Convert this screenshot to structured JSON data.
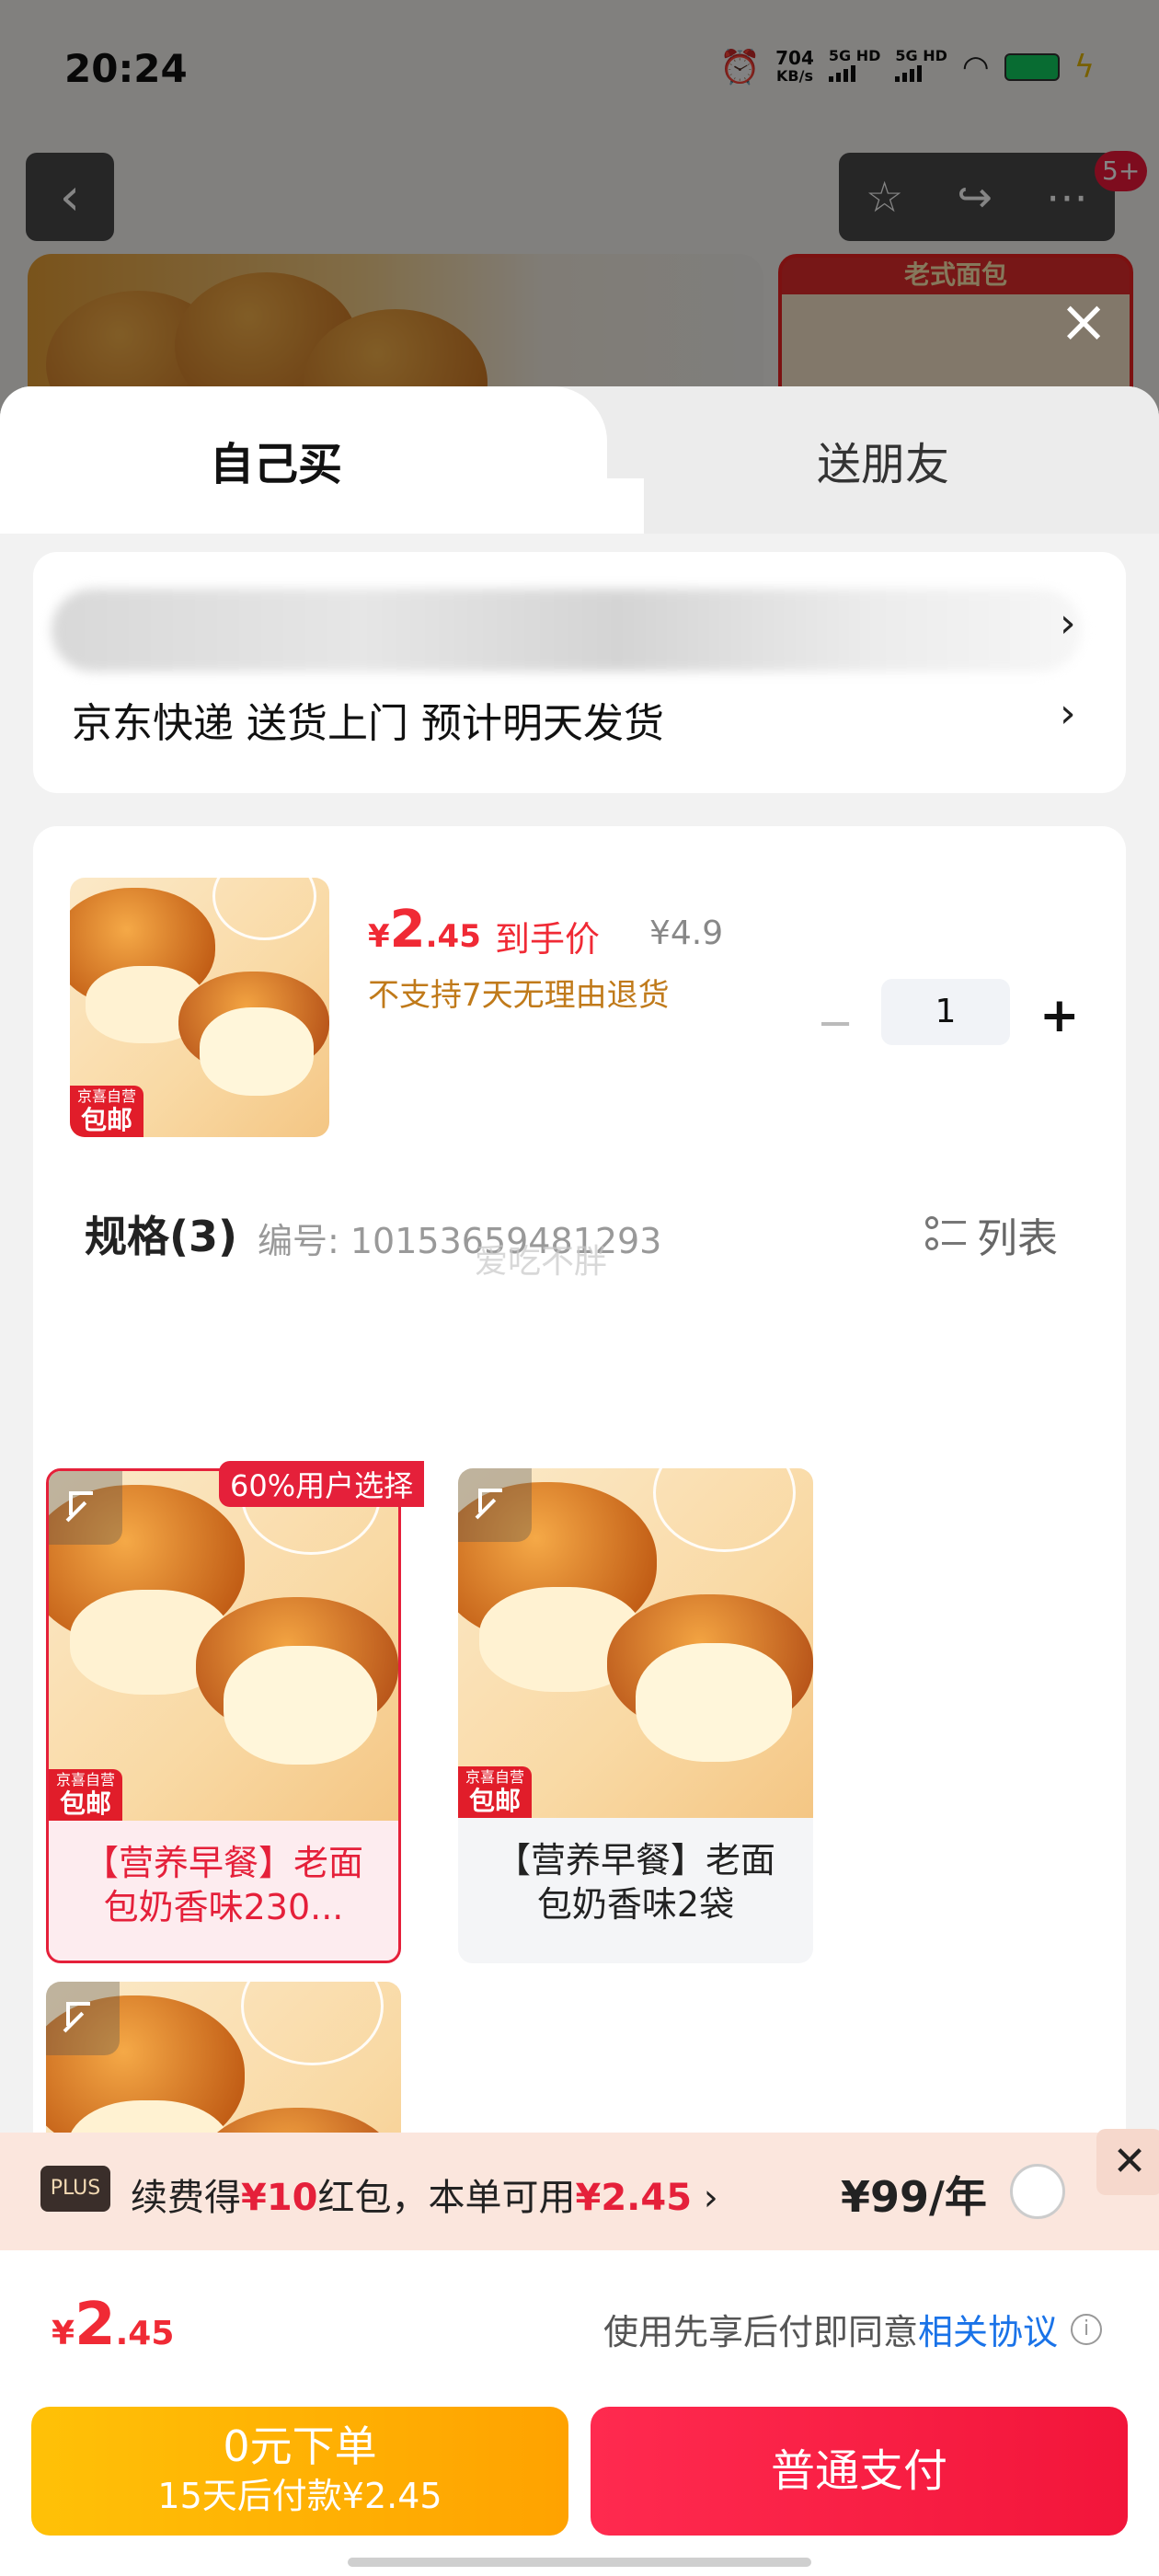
{
  "status_bar": {
    "time": "20:24",
    "net_speed_value": "704",
    "net_speed_unit": "KB/s",
    "sim1": "5G HD",
    "sim2": "5G HD"
  },
  "top_bar": {
    "more_badge": "5+"
  },
  "background": {
    "thumb_label": "老式面包"
  },
  "tabs": {
    "self": "自己买",
    "friend": "送朋友"
  },
  "address": {
    "delivery_text": "京东快递 送货上门 预计明天发货",
    "arrow": "›"
  },
  "product": {
    "price_symbol": "¥",
    "price_int": "2",
    "price_dec": ".45",
    "price_label": "到手价",
    "original_price": "¥4.9",
    "return_note": "不支持7天无理由退货",
    "quantity": "1",
    "minus": "−",
    "plus": "+",
    "badge_line1": "京喜自营",
    "badge_line2": "包邮"
  },
  "spec": {
    "title": "规格(3)",
    "code_label": "编号: 10153659481293",
    "watermark": "爱吃不胖",
    "list_toggle": "列表",
    "popular_tag": "60%用户选择",
    "variants": [
      {
        "text": "【营养早餐】老面包奶香味230...",
        "selected": true
      },
      {
        "text": "【营养早餐】老面包奶香味2袋",
        "selected": false
      },
      {
        "text": "",
        "selected": false
      }
    ]
  },
  "plus_bar": {
    "logo": "PLUS",
    "text_a": "续费得",
    "text_b": "¥10",
    "text_c": "红包，本单可用",
    "text_d": "¥2.45",
    "text_e": " ›",
    "price": "¥99/年",
    "close": "✕"
  },
  "total": {
    "symbol": "¥",
    "int": "2",
    "dec": ".45",
    "agree_text": "使用先享后付即同意",
    "agree_link": "相关协议"
  },
  "buttons": {
    "later_line1": "0元下单",
    "later_line2": "15天后付款¥2.45",
    "pay": "普通支付"
  },
  "colors": {
    "accent_red": "#f02a35",
    "gold": "#ffb300",
    "link_blue": "#1a73e8"
  }
}
